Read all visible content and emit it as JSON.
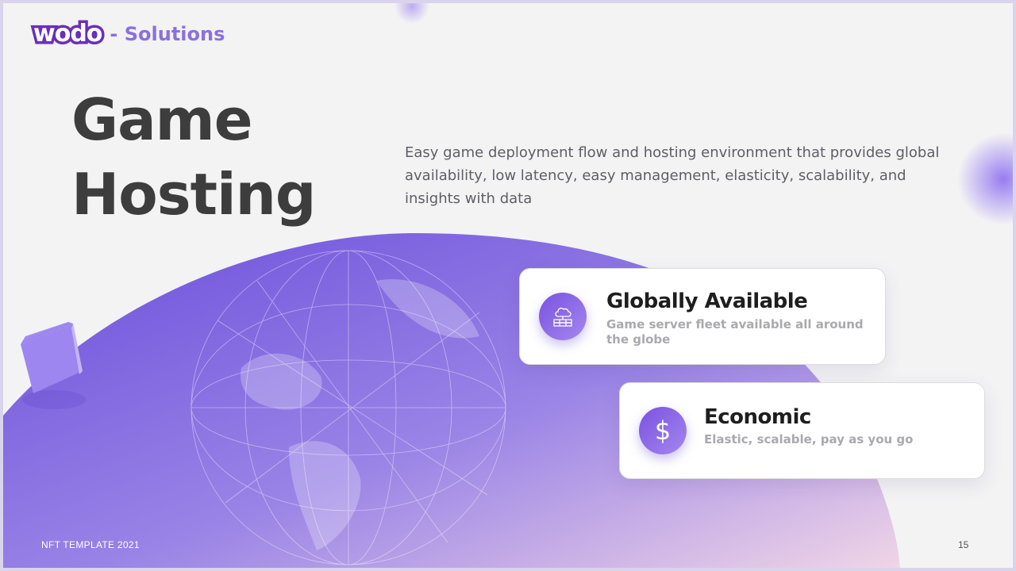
{
  "logo": {
    "word": "wodo",
    "suffix": "- Solutions"
  },
  "title": {
    "line1": "Game",
    "line2": "Hosting"
  },
  "description": "Easy game deployment flow and hosting environment that provides global availability, low latency, easy management, elasticity, scalability, and insights with data",
  "cards": [
    {
      "title": "Globally Available",
      "subtitle": "Game server fleet available all around the globe",
      "icon": "cloud-server-icon"
    },
    {
      "title": "Economic",
      "subtitle": "Elastic, scalable, pay as you go",
      "icon": "dollar-icon"
    }
  ],
  "footer": {
    "left": "NFT TEMPLATE 2021",
    "page_number": "15"
  },
  "colors": {
    "accent": "#7a52e0",
    "accent_light": "#b9a4f0",
    "title": "#3d3d3d"
  }
}
